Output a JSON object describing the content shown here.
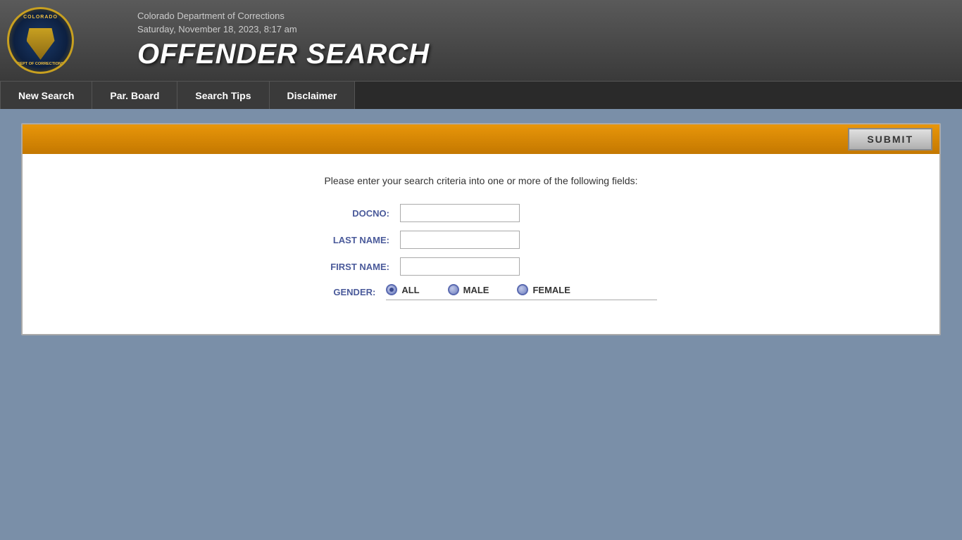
{
  "header": {
    "dept_name": "Colorado Department of Corrections",
    "datetime": "Saturday, November 18, 2023, 8:17 am",
    "title": "OFFENDER SEARCH",
    "logo_state": "COLORADO",
    "logo_bottom": "DEPT OF CORRECTIONS"
  },
  "navbar": {
    "items": [
      {
        "id": "new-search",
        "label": "New Search"
      },
      {
        "id": "par-board",
        "label": "Par. Board"
      },
      {
        "id": "search-tips",
        "label": "Search Tips"
      },
      {
        "id": "disclaimer",
        "label": "Disclaimer"
      }
    ]
  },
  "search_form": {
    "submit_label": "SUBMIT",
    "instructions": "Please enter your search criteria into one or more of the following fields:",
    "fields": [
      {
        "id": "docno",
        "label": "DOCNO:",
        "value": ""
      },
      {
        "id": "last-name",
        "label": "LAST NAME:",
        "value": ""
      },
      {
        "id": "first-name",
        "label": "FIRST NAME:",
        "value": ""
      }
    ],
    "gender": {
      "label": "GENDER:",
      "options": [
        {
          "id": "all",
          "label": "ALL",
          "selected": true
        },
        {
          "id": "male",
          "label": "MALE",
          "selected": false
        },
        {
          "id": "female",
          "label": "FEMALE",
          "selected": false
        }
      ]
    }
  }
}
